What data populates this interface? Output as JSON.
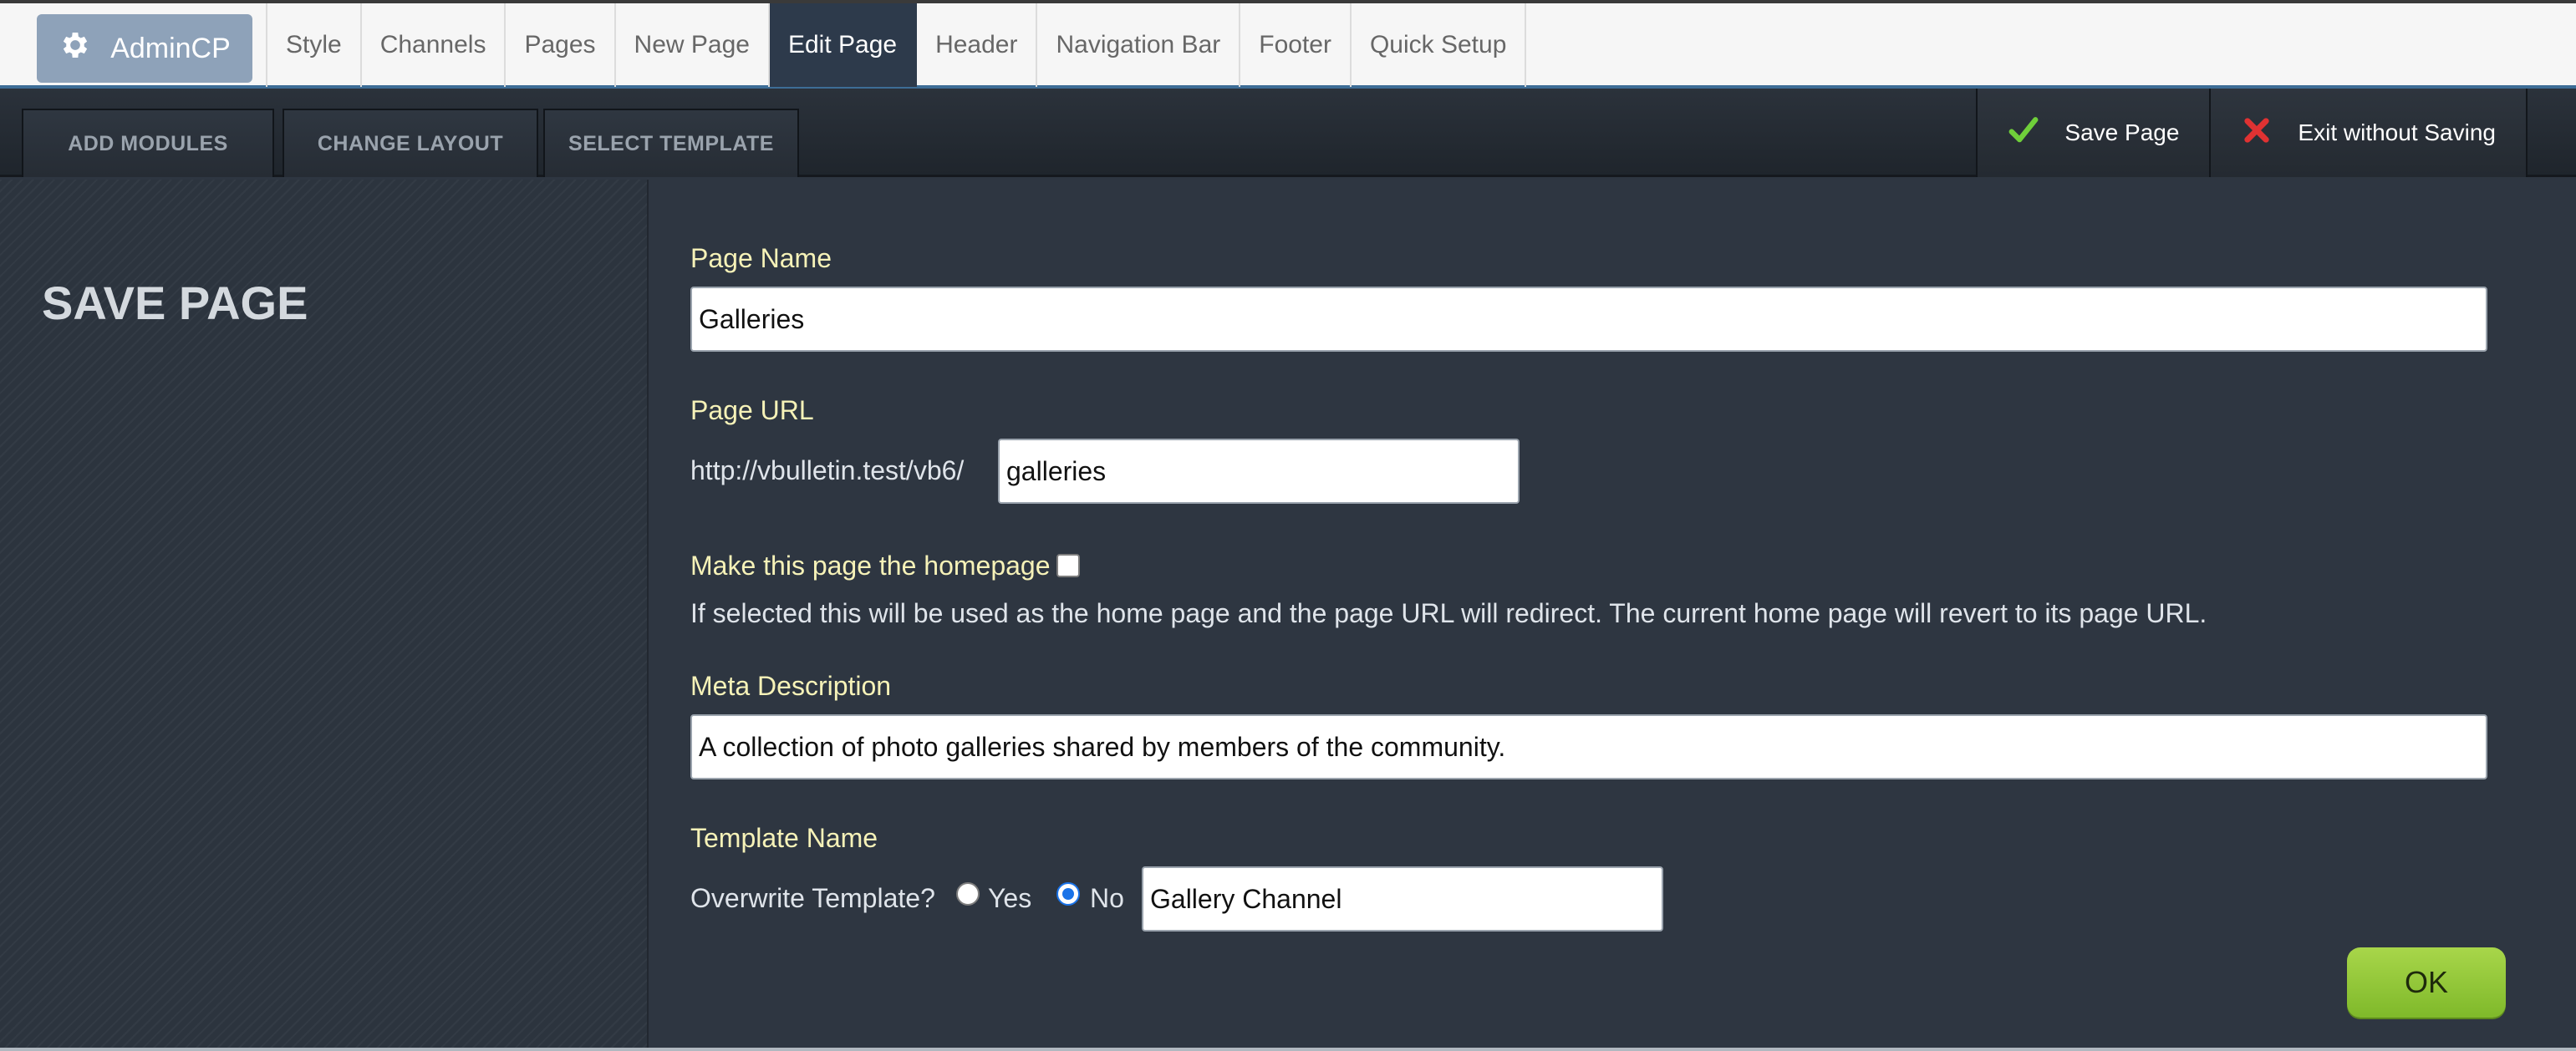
{
  "brand": {
    "label": "AdminCP",
    "icon": "gear-icon"
  },
  "nav": {
    "tabs": [
      {
        "label": "Style"
      },
      {
        "label": "Channels"
      },
      {
        "label": "Pages"
      },
      {
        "label": "New Page"
      },
      {
        "label": "Edit Page",
        "active": true
      },
      {
        "label": "Header"
      },
      {
        "label": "Navigation Bar"
      },
      {
        "label": "Footer"
      },
      {
        "label": "Quick Setup"
      }
    ]
  },
  "toolbar": {
    "add_modules": "ADD MODULES",
    "change_layout": "CHANGE LAYOUT",
    "select_template": "SELECT TEMPLATE",
    "save_page": "Save Page",
    "exit_without_saving": "Exit without Saving"
  },
  "sidebar": {
    "title": "SAVE PAGE"
  },
  "form": {
    "page_name_label": "Page Name",
    "page_name_value": "Galleries",
    "page_url_label": "Page URL",
    "page_url_prefix": "http://vbulletin.test/vb6/",
    "page_url_value": "galleries",
    "homepage_label": "Make this page the homepage",
    "homepage_checked": false,
    "homepage_help": "If selected this will be used as the home page and the page URL will redirect. The current home page will revert to its page URL.",
    "meta_label": "Meta Description",
    "meta_value": "A collection of photo galleries shared by members of the community.",
    "template_label": "Template Name",
    "overwrite_label": "Overwrite Template?",
    "yes_label": "Yes",
    "no_label": "No",
    "overwrite_selected": "No",
    "template_value": "Gallery Channel",
    "ok_label": "OK"
  },
  "colors": {
    "background": "#2e3641",
    "label": "#f6f2b8",
    "active_tab": "#2d3a4b",
    "ok_button": "#8cc63f",
    "save_check": "#6fcf3a",
    "exit_x": "#e03232"
  }
}
